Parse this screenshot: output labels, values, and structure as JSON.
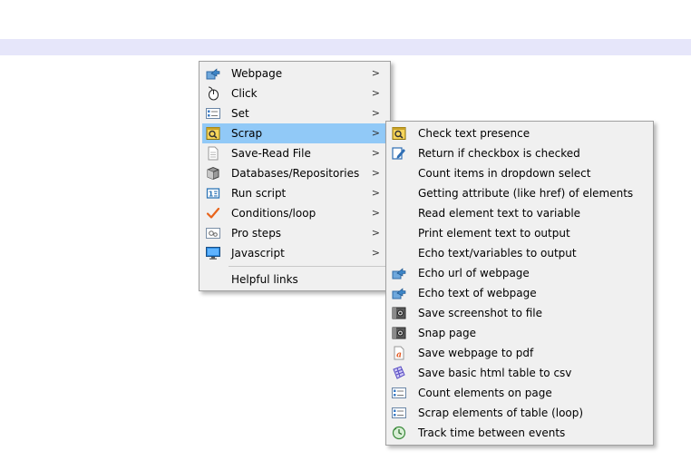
{
  "main_menu": {
    "items": [
      {
        "label": "Webpage",
        "icon": "webpage-arrow-icon",
        "submenu": true
      },
      {
        "label": "Click",
        "icon": "mouse-icon",
        "submenu": true
      },
      {
        "label": "Set",
        "icon": "form-checklist-icon",
        "submenu": true
      },
      {
        "label": "Scrap",
        "icon": "scrap-magnifier-icon",
        "submenu": true,
        "selected": true
      },
      {
        "label": "Save-Read File",
        "icon": "document-icon",
        "submenu": true
      },
      {
        "label": "Databases/Repositories",
        "icon": "database-icon",
        "submenu": true
      },
      {
        "label": "Run script",
        "icon": "script-icon",
        "submenu": true
      },
      {
        "label": "Conditions/loop",
        "icon": "checkmark-icon",
        "submenu": true
      },
      {
        "label": "Pro steps",
        "icon": "gears-icon",
        "submenu": true
      },
      {
        "label": "Javascript",
        "icon": "monitor-icon",
        "submenu": true
      }
    ],
    "footer_label": "Helpful links",
    "arrow_glyph": ">"
  },
  "sub_menu": {
    "items": [
      {
        "label": "Check text presence",
        "icon": "scrap-magnifier-icon"
      },
      {
        "label": "Return if checkbox is checked",
        "icon": "edit-pencil-icon"
      },
      {
        "label": "Count items in dropdown select",
        "icon": ""
      },
      {
        "label": "Getting attribute (like href) of elements",
        "icon": ""
      },
      {
        "label": "Read element text to variable",
        "icon": ""
      },
      {
        "label": "Print element text to output",
        "icon": ""
      },
      {
        "label": "Echo text/variables to output",
        "icon": ""
      },
      {
        "label": "Echo url of webpage",
        "icon": "webpage-arrow-icon"
      },
      {
        "label": "Echo text of webpage",
        "icon": "webpage-arrow-icon"
      },
      {
        "label": "Save screenshot to file",
        "icon": "camera-icon"
      },
      {
        "label": "Snap page",
        "icon": "camera-icon"
      },
      {
        "label": "Save webpage to pdf",
        "icon": "pdf-icon"
      },
      {
        "label": "Save basic html table to csv",
        "icon": "table-icon"
      },
      {
        "label": "Count elements on page",
        "icon": "form-checklist-icon"
      },
      {
        "label": "Scrap elements of table (loop)",
        "icon": "form-checklist-icon"
      },
      {
        "label": "Track time between events",
        "icon": "clock-icon"
      }
    ]
  },
  "colors": {
    "menu_bg": "#f0f0f0",
    "selected_bg": "#91c9f7",
    "strip_bg": "#e6e6fa"
  }
}
